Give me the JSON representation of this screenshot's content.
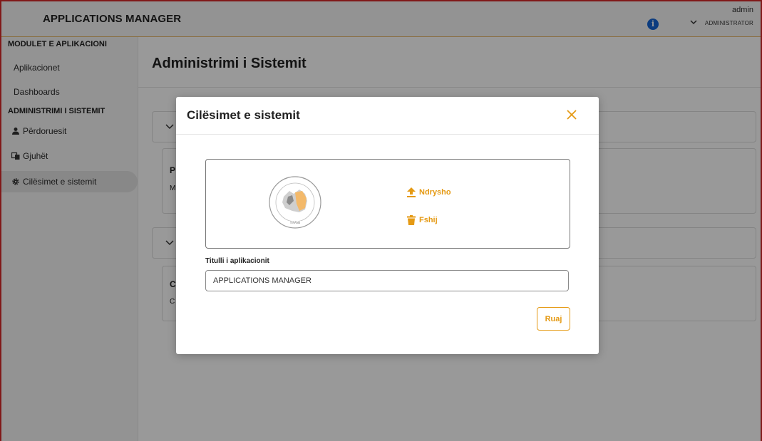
{
  "header": {
    "app_title": "APPLICATIONS MANAGER",
    "info_icon": "info-icon",
    "user_name": "admin",
    "user_role": "ADMINISTRATOR"
  },
  "sidebar": {
    "section_modules": "MODULET E APLIKACIONI",
    "items_modules": [
      {
        "label": "Aplikacionet"
      },
      {
        "label": "Dashboards"
      }
    ],
    "section_admin": "ADMINISTRIMI I SISTEMIT",
    "items_admin": [
      {
        "label": "Përdoruesit",
        "icon": "user-icon"
      },
      {
        "label": "Gjuhët",
        "icon": "language-icon"
      },
      {
        "label": "Cilësimet e sistemit",
        "icon": "gear-icon",
        "active": true
      }
    ]
  },
  "main": {
    "page_title": "Administrimi i Sistemit",
    "card_letters": [
      "P",
      "M",
      "C",
      "C"
    ]
  },
  "modal": {
    "title": "Cilësimet e sistemit",
    "logo_caption": "TIRANE",
    "change_label": "Ndrysho",
    "delete_label": "Fshij",
    "field_label": "Titulli i aplikacionit",
    "field_value": "APPLICATIONS MANAGER",
    "save_label": "Ruaj"
  },
  "colors": {
    "accent": "#e59a14",
    "info": "#1465d4",
    "frame": "#d62b2b"
  }
}
